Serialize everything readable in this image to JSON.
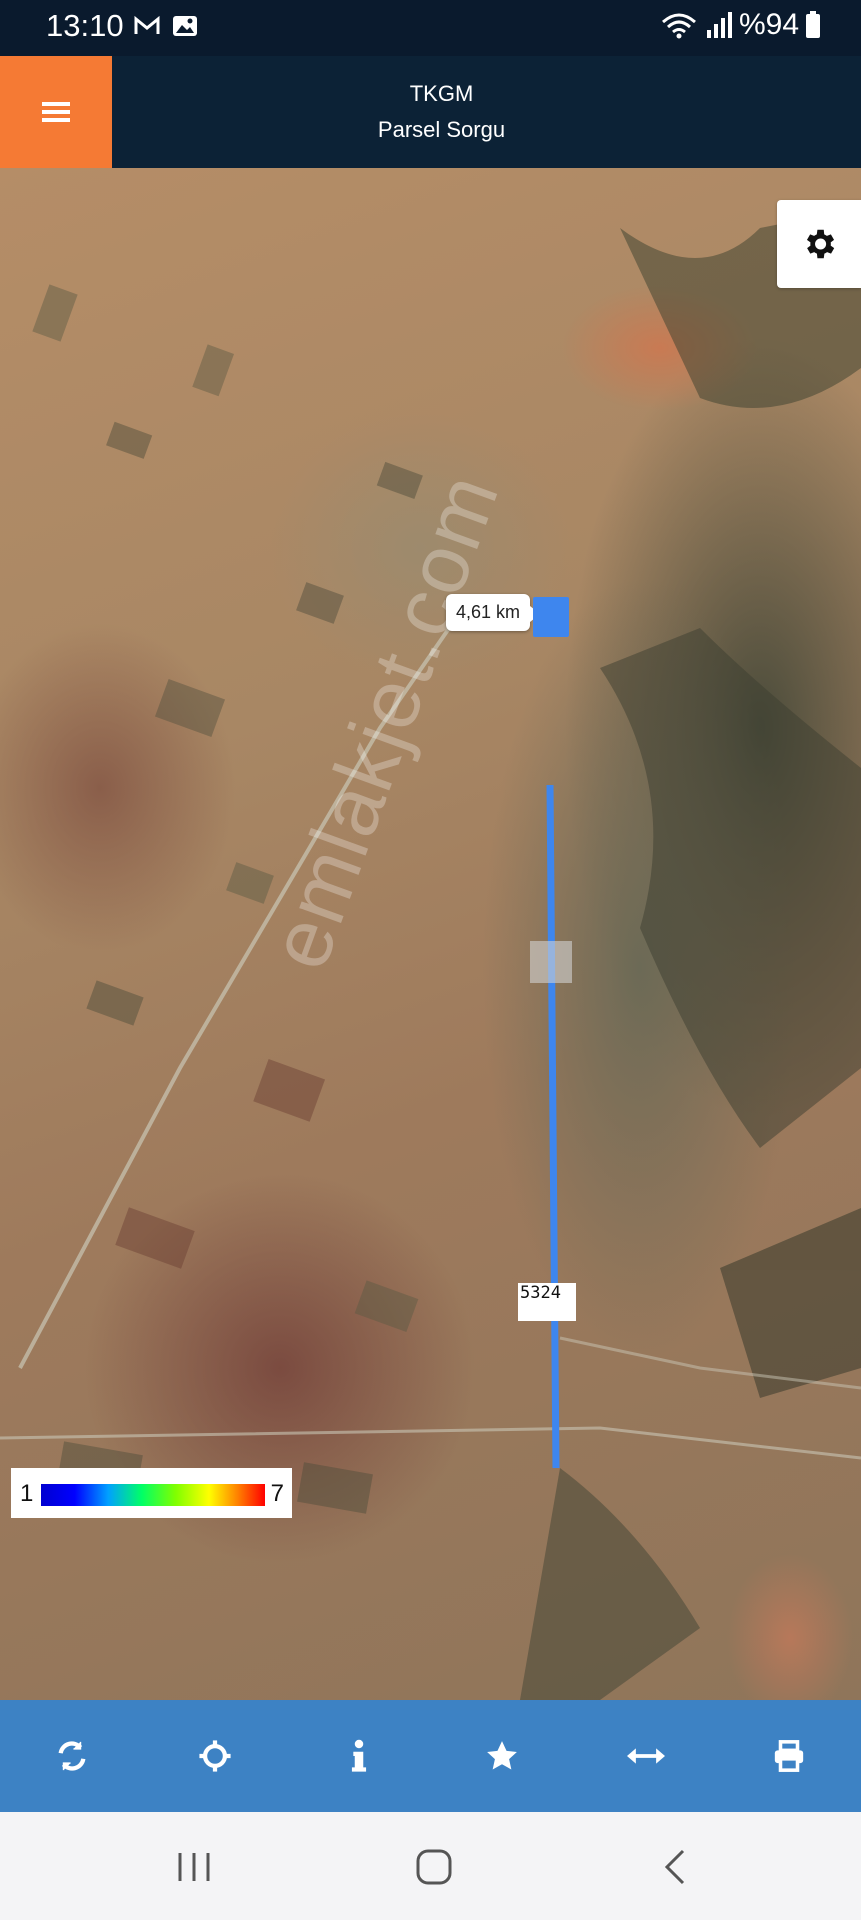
{
  "status_bar": {
    "time": "13:10",
    "battery": "%94",
    "icons": [
      "mail-icon",
      "photo-icon",
      "wifi-icon",
      "signal-icon",
      "battery-icon"
    ]
  },
  "header": {
    "title": "TKGM",
    "subtitle": "Parsel Sorgu",
    "menu_icon": "hamburger-icon",
    "colors": {
      "menu_bg": "#f57a34",
      "header_bg": "#0c2236"
    }
  },
  "map": {
    "measurement_label": "4,61 km",
    "endpoint_label": "5324",
    "watermark": "emlakjet.com",
    "settings_icon": "gear-icon",
    "measure_line_color": "#3e86ee",
    "legend": {
      "min": "1",
      "max": "7"
    }
  },
  "toolbar": {
    "background": "#3d82c4",
    "tools": [
      "refresh-icon",
      "locate-icon",
      "info-icon",
      "favorite-icon",
      "measure-icon",
      "print-icon"
    ]
  },
  "nav_bar": {
    "buttons": [
      "recent-apps-icon",
      "home-icon",
      "back-icon"
    ]
  }
}
